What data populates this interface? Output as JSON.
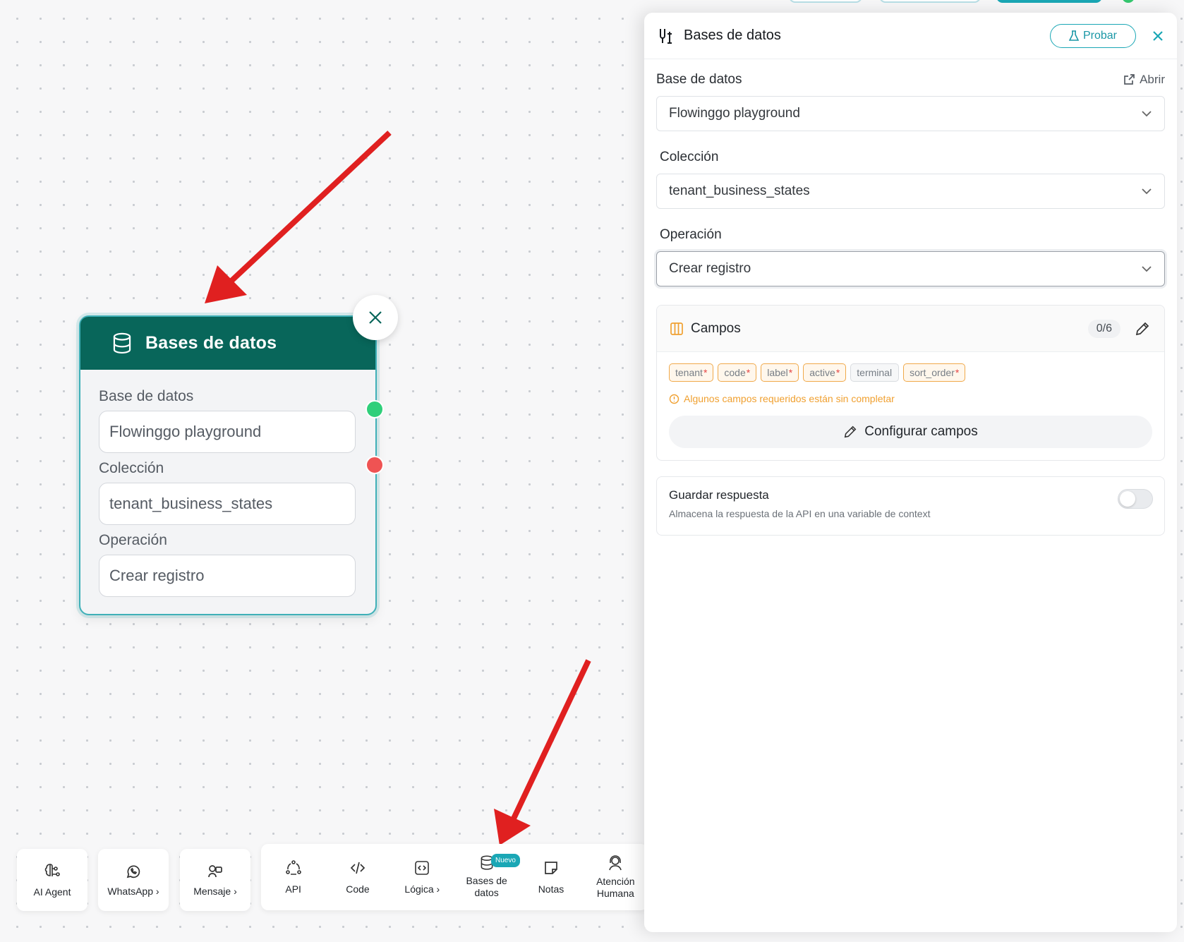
{
  "canvas_node": {
    "title": "Bases de datos",
    "fields": [
      {
        "label": "Base de datos",
        "value": "Flowinggo playground"
      },
      {
        "label": "Colección",
        "value": "tenant_business_states"
      },
      {
        "label": "Operación",
        "value": "Crear registro"
      }
    ]
  },
  "toolbar": {
    "ai_agent": "AI Agent",
    "whatsapp": "WhatsApp ›",
    "mensaje": "Mensaje ›",
    "api": "API",
    "code": "Code",
    "logica": "Lógica ›",
    "bases_line1": "Bases de",
    "bases_line2": "datos",
    "nuevo_badge": "Nuevo",
    "notas": "Notas",
    "atencion_line1": "Atención",
    "atencion_line2": "Humana"
  },
  "panel": {
    "title": "Bases de datos",
    "probar_label": "Probar",
    "db_label": "Base de datos",
    "abrir_label": "Abrir",
    "db_value": "Flowinggo playground",
    "collection_label": "Colección",
    "collection_value": "tenant_business_states",
    "operation_label": "Operación",
    "operation_value": "Crear registro",
    "campos": {
      "title": "Campos",
      "count": "0/6",
      "tags": [
        {
          "name": "tenant",
          "required": "*"
        },
        {
          "name": "code",
          "required": "*"
        },
        {
          "name": "label",
          "required": "*"
        },
        {
          "name": "active",
          "required": "*"
        },
        {
          "name": "terminal",
          "required": ""
        },
        {
          "name": "sort_order",
          "required": "*"
        }
      ],
      "warning": "Algunos campos requeridos están sin completar",
      "configure_label": "Configurar campos"
    },
    "guardar": {
      "title": "Guardar respuesta",
      "description": "Almacena la respuesta de la API en una variable de context"
    }
  },
  "colors": {
    "node_header": "#08665a",
    "accent": "#1aa7b5",
    "warning": "#f0a030",
    "arrow": "#e02020"
  }
}
